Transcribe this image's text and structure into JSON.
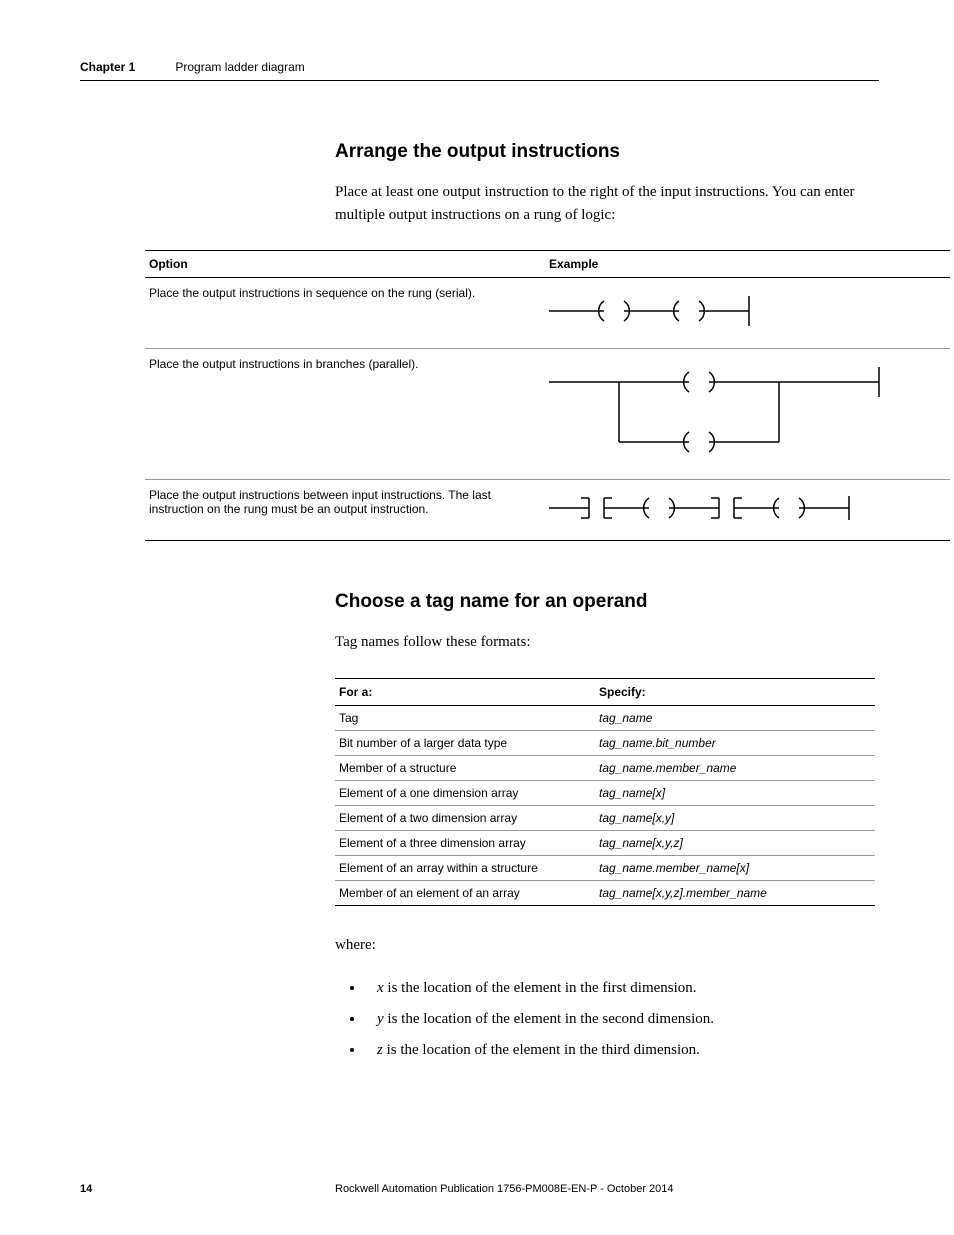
{
  "header": {
    "chapter_label": "Chapter 1",
    "chapter_title": "Program ladder diagram"
  },
  "section1": {
    "heading": "Arrange the output instructions",
    "intro": "Place at least one output instruction to the right of the input instructions. You can enter multiple output instructions on a rung of logic:",
    "th_option": "Option",
    "th_example": "Example",
    "rows": [
      "Place the output instructions in sequence on the rung (serial).",
      "Place the output instructions in branches (parallel).",
      "Place the output instructions between input instructions. The last instruction on the rung must be an output instruction."
    ]
  },
  "section2": {
    "heading": "Choose a tag name for an operand",
    "intro": "Tag names follow these formats:",
    "th_for": "For a:",
    "th_spec": "Specify:",
    "rows": [
      {
        "for": "Tag",
        "spec": "tag_name"
      },
      {
        "for": "Bit number of a larger data type",
        "spec": "tag_name.bit_number"
      },
      {
        "for": "Member of a structure",
        "spec": "tag_name.member_name"
      },
      {
        "for": "Element of a one dimension array",
        "spec": "tag_name[x]"
      },
      {
        "for": "Element of a two dimension array",
        "spec": "tag_name[x,y]"
      },
      {
        "for": "Element of a three dimension array",
        "spec": "tag_name[x,y,z]"
      },
      {
        "for": "Element of an array within a structure",
        "spec": "tag_name.member_name[x]"
      },
      {
        "for": "Member of an element of an array",
        "spec": "tag_name[x,y,z].member_name"
      }
    ],
    "where_label": "where:",
    "bullets": [
      {
        "var": "x",
        "rest": " is the location of the element in the first dimension."
      },
      {
        "var": "y",
        "rest": " is the location of the element in the second dimension."
      },
      {
        "var": "z",
        "rest": " is the location of the element in the third dimension."
      }
    ]
  },
  "footer": {
    "page": "14",
    "pub": "Rockwell Automation Publication 1756-PM008E-EN-P - October 2014"
  }
}
